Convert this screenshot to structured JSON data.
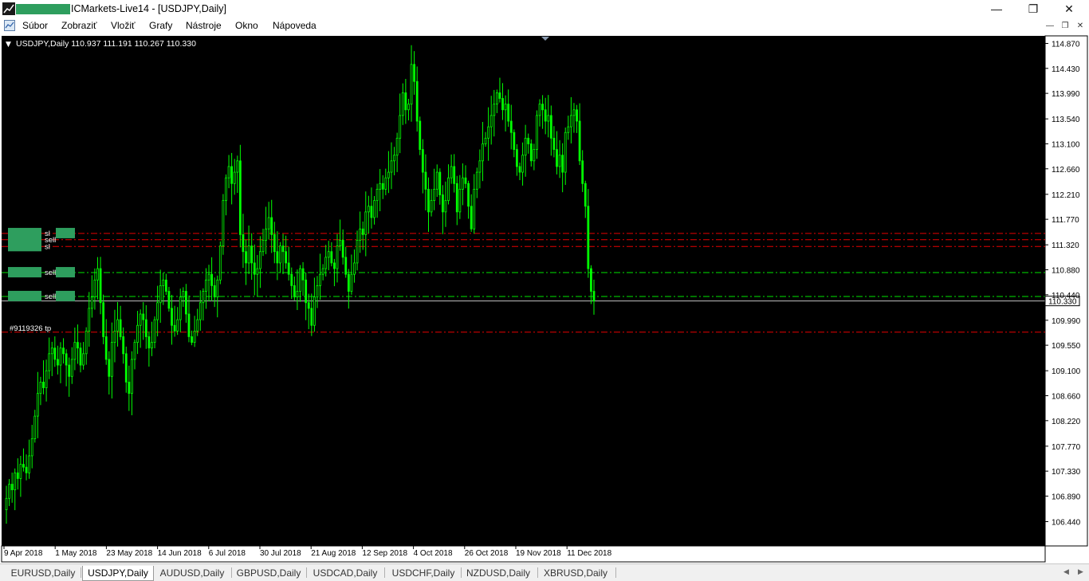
{
  "window": {
    "title": "ICMarkets-Live14 - [USDJPY,Daily]",
    "controls": {
      "minimize": "—",
      "restore": "❐",
      "close": "✕"
    }
  },
  "menu": {
    "items": [
      "Súbor",
      "Zobraziť",
      "Vložiť",
      "Grafy",
      "Nástroje",
      "Okno",
      "Nápoveda"
    ]
  },
  "chart": {
    "header": "USDJPY,Daily  110.937 111.191 110.267 110.330",
    "current_price": "110.330",
    "colors": {
      "background": "#000000",
      "candle": "#00ff00",
      "sl_line": "#ff0000",
      "tp_line": "#00ff00",
      "bid_line": "#c0c0c0",
      "label_mask": "#2e9e5e"
    },
    "order_labels": [
      {
        "text": "sl",
        "price": 111.52
      },
      {
        "text": "sell",
        "price": 111.41
      },
      {
        "text": "sl",
        "price": 111.29
      },
      {
        "text": "sell",
        "price": 110.83
      },
      {
        "text": "sell",
        "price": 110.41
      },
      {
        "text": "#9119326 tp",
        "price": 109.78
      }
    ]
  },
  "chart_data": {
    "type": "candlestick",
    "symbol": "USDJPY",
    "timeframe": "Daily",
    "ohlc_last": {
      "open": 110.937,
      "high": 111.191,
      "low": 110.267,
      "close": 110.33
    },
    "y_ticks": [
      114.87,
      114.43,
      113.99,
      113.54,
      113.1,
      112.66,
      112.21,
      111.77,
      111.32,
      110.88,
      110.44,
      109.99,
      109.55,
      109.1,
      108.66,
      108.22,
      107.77,
      107.33,
      106.89,
      106.44
    ],
    "y_tick_labels": [
      "114.870",
      "114.430",
      "113.990",
      "113.540",
      "113.100",
      "112.660",
      "112.210",
      "111.770",
      "111.320",
      "110.880",
      "110.440",
      "109.990",
      "109.550",
      "109.100",
      "108.660",
      "108.220",
      "107.770",
      "107.330",
      "106.890",
      "106.440"
    ],
    "x_tick_labels": [
      "9 Apr 2018",
      "1 May 2018",
      "23 May 2018",
      "14 Jun 2018",
      "6 Jul 2018",
      "30 Jul 2018",
      "21 Aug 2018",
      "12 Sep 2018",
      "4 Oct 2018",
      "26 Oct 2018",
      "19 Nov 2018",
      "11 Dec 2018"
    ],
    "ylim": [
      106.3,
      115.08
    ],
    "closes": [
      106.85,
      107.1,
      107.0,
      107.3,
      107.2,
      107.45,
      107.4,
      107.3,
      107.6,
      107.9,
      108.3,
      108.7,
      108.9,
      108.8,
      109.1,
      109.4,
      109.5,
      109.3,
      109.2,
      109.5,
      109.4,
      109.2,
      109.0,
      109.3,
      109.6,
      109.5,
      109.2,
      109.4,
      109.8,
      110.2,
      110.4,
      110.7,
      110.9,
      110.3,
      109.7,
      109.3,
      109.0,
      109.6,
      109.8,
      110.0,
      109.7,
      109.4,
      108.9,
      108.7,
      109.3,
      109.6,
      109.9,
      110.1,
      110.0,
      109.7,
      109.5,
      109.6,
      110.0,
      110.3,
      110.6,
      110.7,
      110.5,
      110.2,
      109.9,
      109.8,
      110.0,
      110.4,
      110.5,
      110.1,
      109.7,
      109.6,
      109.8,
      110.0,
      110.3,
      110.5,
      110.7,
      110.8,
      110.6,
      110.4,
      110.7,
      111.3,
      112.1,
      112.5,
      112.7,
      112.4,
      112.6,
      112.8,
      111.5,
      111.2,
      111.0,
      111.3,
      111.0,
      110.8,
      110.9,
      111.2,
      111.4,
      111.6,
      111.8,
      111.5,
      111.2,
      111.0,
      111.3,
      111.2,
      111.0,
      110.8,
      110.6,
      110.4,
      110.5,
      110.9,
      110.7,
      110.3,
      110.2,
      109.9,
      110.4,
      110.6,
      110.8,
      110.9,
      111.1,
      111.2,
      111.0,
      110.9,
      111.3,
      111.4,
      111.1,
      110.8,
      110.5,
      110.8,
      111.0,
      111.4,
      111.6,
      111.5,
      111.9,
      112.0,
      111.8,
      112.1,
      112.3,
      112.4,
      112.3,
      112.5,
      112.6,
      112.8,
      112.9,
      113.2,
      113.6,
      114.0,
      113.7,
      113.8,
      114.5,
      114.2,
      113.5,
      113.0,
      112.6,
      112.3,
      111.9,
      112.1,
      112.3,
      112.6,
      112.2,
      111.9,
      112.1,
      112.5,
      112.7,
      112.4,
      111.9,
      112.3,
      112.5,
      112.4,
      112.0,
      111.6,
      112.3,
      112.6,
      112.8,
      113.1,
      113.2,
      113.4,
      113.6,
      113.8,
      114.0,
      113.9,
      113.7,
      113.8,
      113.5,
      113.3,
      113.0,
      112.7,
      112.6,
      112.9,
      113.2,
      113.1,
      112.8,
      113.0,
      113.6,
      113.8,
      113.7,
      113.5,
      113.6,
      113.2,
      113.0,
      112.7,
      112.9,
      112.6,
      113.3,
      113.4,
      113.6,
      113.7,
      113.5,
      112.8,
      112.4,
      112.0,
      110.9,
      110.5,
      110.33
    ]
  },
  "tabs": [
    {
      "label": "EURUSD,Daily",
      "active": false
    },
    {
      "label": "USDJPY,Daily",
      "active": true
    },
    {
      "label": "AUDUSD,Daily",
      "active": false
    },
    {
      "label": "GBPUSD,Daily",
      "active": false
    },
    {
      "label": "USDCAD,Daily",
      "active": false
    },
    {
      "label": "USDCHF,Daily",
      "active": false
    },
    {
      "label": "NZDUSD,Daily",
      "active": false
    },
    {
      "label": "XBRUSD,Daily",
      "active": false
    }
  ],
  "tab_scroll": {
    "left": "◀",
    "right": "▶"
  }
}
